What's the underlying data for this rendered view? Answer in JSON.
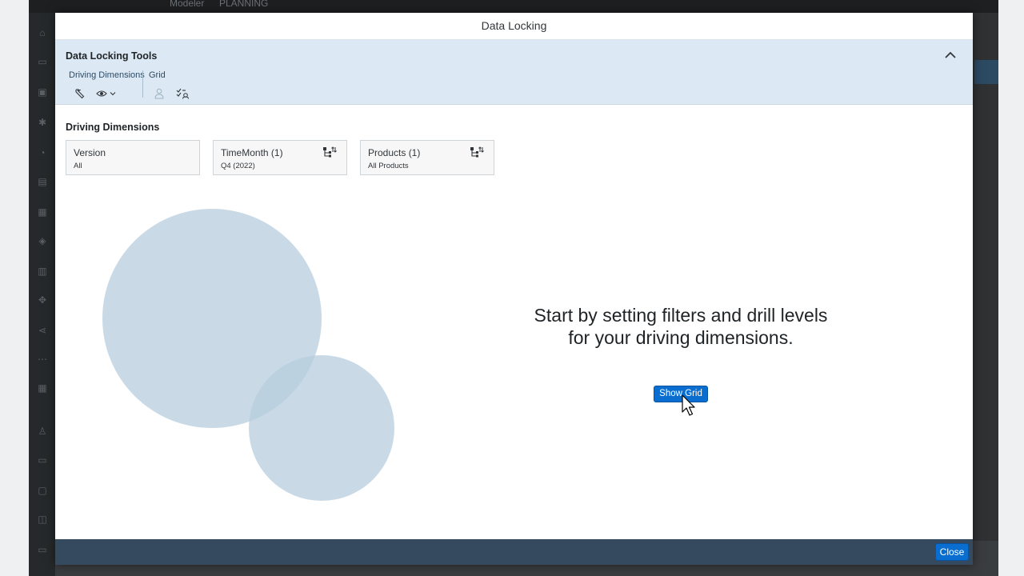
{
  "background_app": {
    "shell_title": "Modeler",
    "shell_section": "PLANNING"
  },
  "dialog": {
    "title": "Data Locking",
    "tools": {
      "title": "Data Locking Tools",
      "groups": [
        {
          "label": "Driving Dimensions"
        },
        {
          "label": "Grid"
        }
      ],
      "icons": [
        "wrench-icon",
        "eye-icon",
        "chevron-down-icon",
        "person-icon",
        "grid-lock-icon"
      ]
    },
    "driving_dimensions": {
      "title": "Driving Dimensions",
      "tiles": [
        {
          "name": "Version",
          "value": "All",
          "has_drill": false
        },
        {
          "name": "TimeMonth (1)",
          "value": "Q4 (2022)",
          "has_drill": true
        },
        {
          "name": "Products (1)",
          "value": "All Products",
          "has_drill": true
        }
      ]
    },
    "empty_state": {
      "line1": "Start by setting filters and drill levels",
      "line2": "for your driving dimensions.",
      "button": "Show Grid"
    },
    "footer": {
      "close_label": "Close"
    }
  },
  "colors": {
    "accent": "#0a6ed1",
    "toolbar_bg": "#dce9f4",
    "footer_bg": "#354a5f",
    "circle": "#b7cddd"
  }
}
